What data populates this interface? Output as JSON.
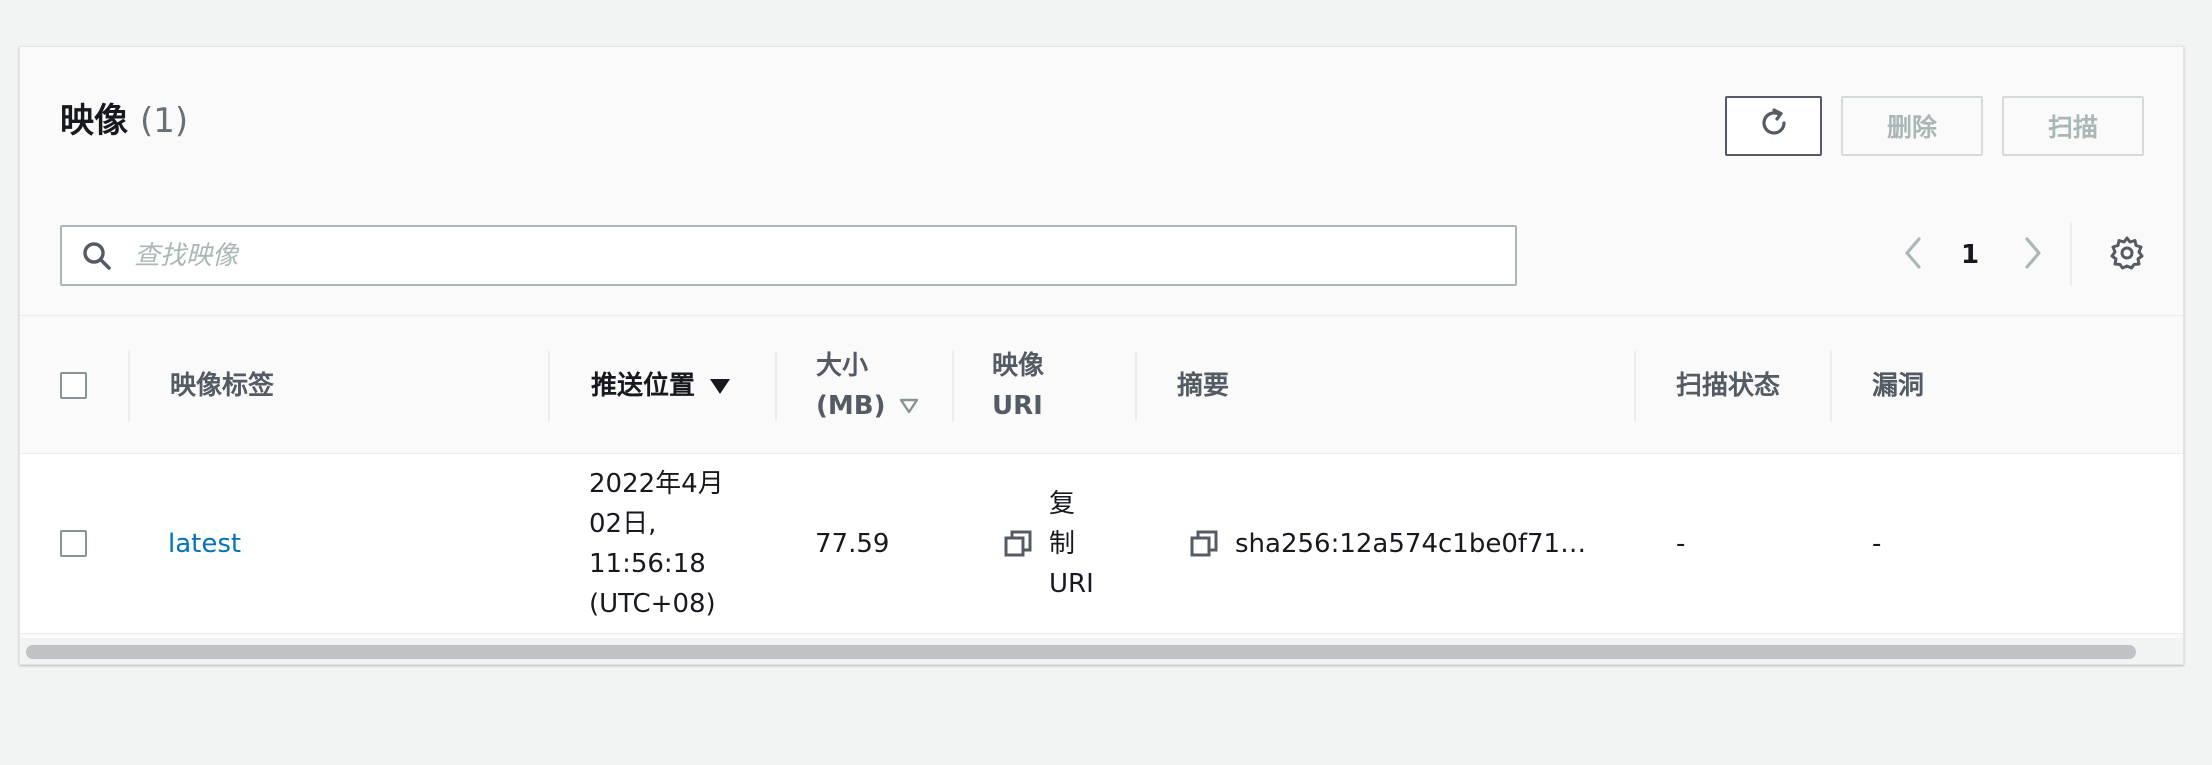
{
  "header": {
    "title": "映像",
    "count": "(1)",
    "delete_label": "删除",
    "scan_label": "扫描"
  },
  "search": {
    "placeholder": "查找映像"
  },
  "pagination": {
    "current_page": "1"
  },
  "table": {
    "columns": {
      "tag": "映像标签",
      "pushed_at": "推送位置",
      "size_line1": "大小",
      "size_line2": "(MB)",
      "uri_line1": "映像",
      "uri_line2": "URI",
      "digest": "摘要",
      "scan_status": "扫描状态",
      "vulnerabilities": "漏洞"
    },
    "rows": [
      {
        "tag": "latest",
        "pushed_line1": "2022年4月",
        "pushed_line2": "02日,",
        "pushed_line3": "11:56:18",
        "pushed_line4": "(UTC+08)",
        "size": "77.59",
        "copy_line1": "复",
        "copy_line2": "制",
        "copy_line3": "URI",
        "digest": "sha256:12a574c1be0f71…",
        "scan_status": "-",
        "vulnerabilities": "-"
      }
    ]
  },
  "colors": {
    "link": "#0073bb",
    "page_bg": "#f2f3f3",
    "border": "#aab7b8"
  }
}
